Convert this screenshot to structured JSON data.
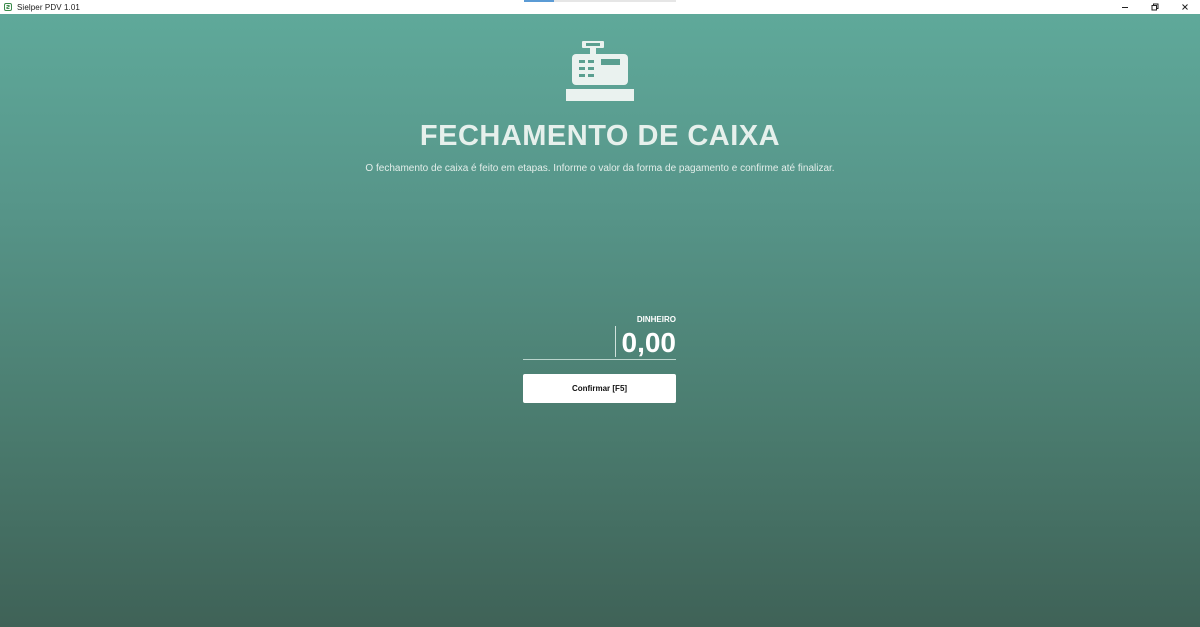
{
  "window": {
    "title": "Sielper PDV 1.01",
    "load_progress": 0.2
  },
  "icons": {
    "app": "app-logo-icon",
    "hero": "cash-register-icon",
    "minimize": "minimize-icon",
    "restore": "restore-icon",
    "close": "close-icon"
  },
  "page": {
    "title": "FECHAMENTO DE CAIXA",
    "subtitle": "O fechamento de caixa é feito em etapas. Informe o valor da forma de pagamento e confirme até finalizar."
  },
  "payment": {
    "method_label": "DINHEIRO",
    "amount_value": "0,00"
  },
  "actions": {
    "confirm_label": "Confirmar [F5]"
  },
  "colors": {
    "background_top": "#5fa99a",
    "background_bottom": "#3f6257",
    "text_light": "#e6f0ec",
    "button_bg": "#ffffff"
  }
}
